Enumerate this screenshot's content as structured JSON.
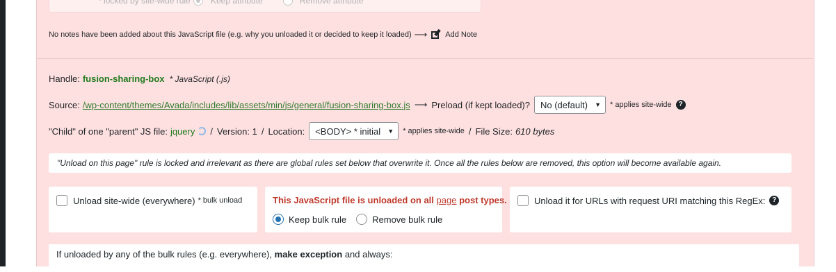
{
  "top_box": {
    "locked_note": "* locked by site-wide rule",
    "keep_label": "Keep attribute",
    "remove_label": "Remove attribute"
  },
  "notes": {
    "text": "No notes have been added about this JavaScript file (e.g. why you unloaded it or decided to keep it loaded)",
    "arrow": "⟶",
    "add_note_label": "Add Note"
  },
  "asset": {
    "handle_label": "Handle:",
    "handle_value": "fusion-sharing-box",
    "type_label": "* JavaScript (.js)",
    "source_label": "Source:",
    "source_path": "/wp-content/themes/Avada/includes/lib/assets/min/js/general/fusion-sharing-box.js",
    "arrow": "⟶",
    "preload_label": "Preload (if kept loaded)?",
    "preload_value": "No (default)",
    "applies_site_wide": "* applies site-wide",
    "child_label": "\"Child\" of one \"parent\" JS file:",
    "parent_value": "jquery",
    "sep": "/",
    "version_label": "Version: 1",
    "location_label": "Location:",
    "location_value": "<BODY> * initial",
    "applies_site_wide_2": "* applies site-wide",
    "file_size_label": "File Size:",
    "file_size_value": "610 bytes"
  },
  "info": {
    "text": "\"Unload on this page\" rule is locked and irrelevant as there are global rules set below that overwrite it. Once all the rules below are removed, this option will become available again."
  },
  "cards": {
    "site_wide_label": "Unload site-wide (everywhere)",
    "bulk_unload_note": "* bulk unload",
    "unloaded_prefix": "This JavaScript file is unloaded on all",
    "unloaded_link": "page",
    "unloaded_suffix": "post types.",
    "keep_bulk_label": "Keep bulk rule",
    "remove_bulk_label": "Remove bulk rule",
    "regex_label": "Unload it for URLs with request URI matching this RegEx:"
  },
  "bottom": {
    "prefix": "If unloaded by any of the bulk rules (e.g. everywhere),",
    "bold": "make exception",
    "suffix": "and always:"
  },
  "colors": {
    "panel_bg": "#ffe0e0",
    "handle_green": "#1e7b1e",
    "warning_red": "#c0392b",
    "radio_blue": "#2271b1"
  }
}
